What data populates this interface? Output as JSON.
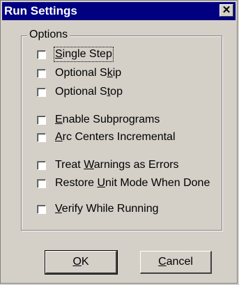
{
  "window": {
    "title": "Run Settings",
    "close_glyph": "✕"
  },
  "options": {
    "group_label": "Options",
    "items": [
      {
        "pre": "",
        "key": "S",
        "post": "ingle Step",
        "checked": false,
        "focused": true
      },
      {
        "pre": "Optional S",
        "key": "k",
        "post": "ip",
        "checked": false
      },
      {
        "pre": "Optional S",
        "key": "t",
        "post": "op",
        "checked": false
      },
      {
        "pre": "",
        "key": "E",
        "post": "nable Subprograms",
        "checked": false
      },
      {
        "pre": "",
        "key": "A",
        "post": "rc Centers Incremental",
        "checked": false
      },
      {
        "pre": "Treat ",
        "key": "W",
        "post": "arnings as Errors",
        "checked": false
      },
      {
        "pre": "Restore ",
        "key": "U",
        "post": "nit Mode When Done",
        "checked": false
      },
      {
        "pre": "",
        "key": "V",
        "post": "erify While Running",
        "checked": false
      }
    ]
  },
  "buttons": {
    "ok": {
      "key": "O",
      "post": "K"
    },
    "cancel": {
      "key": "C",
      "post": "ancel"
    }
  }
}
